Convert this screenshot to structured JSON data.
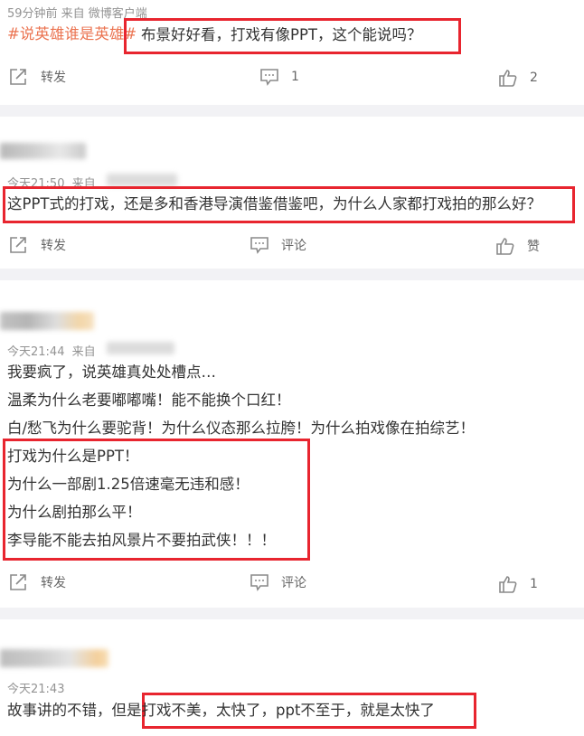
{
  "post1": {
    "meta": "59分钟前 来自 微博客户端",
    "hashtag": "#说英雄谁是英雄#",
    "text": "布景好好看，打戏有像PPT，这个能说吗？",
    "actions": {
      "repost": "转发",
      "comment_count": "1",
      "like_count": "2"
    }
  },
  "post2": {
    "time": "今天21:50",
    "from": "来自",
    "text": "这PPT式的打戏，还是多和香港导演借鉴借鉴吧，为什么人家都打戏拍的那么好？",
    "actions": {
      "repost": "转发",
      "comment": "评论",
      "like": "赞"
    }
  },
  "post3": {
    "time": "今天21:44",
    "from": "来自",
    "lines": [
      "我要疯了，说英雄真处处槽点…",
      "温柔为什么老要嘟嘟嘴！能不能换个口红！",
      "白/愁飞为什么要驼背！为什么仪态那么拉胯！为什么拍戏像在拍综艺！",
      "打戏为什么是PPT！",
      "为什么一部剧1.25倍速毫无违和感！",
      "为什么剧拍那么平！",
      "李导能不能去拍风景片不要拍武侠！！！"
    ],
    "actions": {
      "repost": "转发",
      "comment": "评论",
      "like_count": "1"
    }
  },
  "post4": {
    "time": "今天21:43",
    "text_prefix": "故事讲的不错，但是",
    "text_highlight": "打戏不美，太快了，ppt不至于，就是太快了"
  },
  "colors": {
    "accent_orange": "#eb7350",
    "highlight_red": "#e8252f",
    "meta_gray": "#939393"
  }
}
